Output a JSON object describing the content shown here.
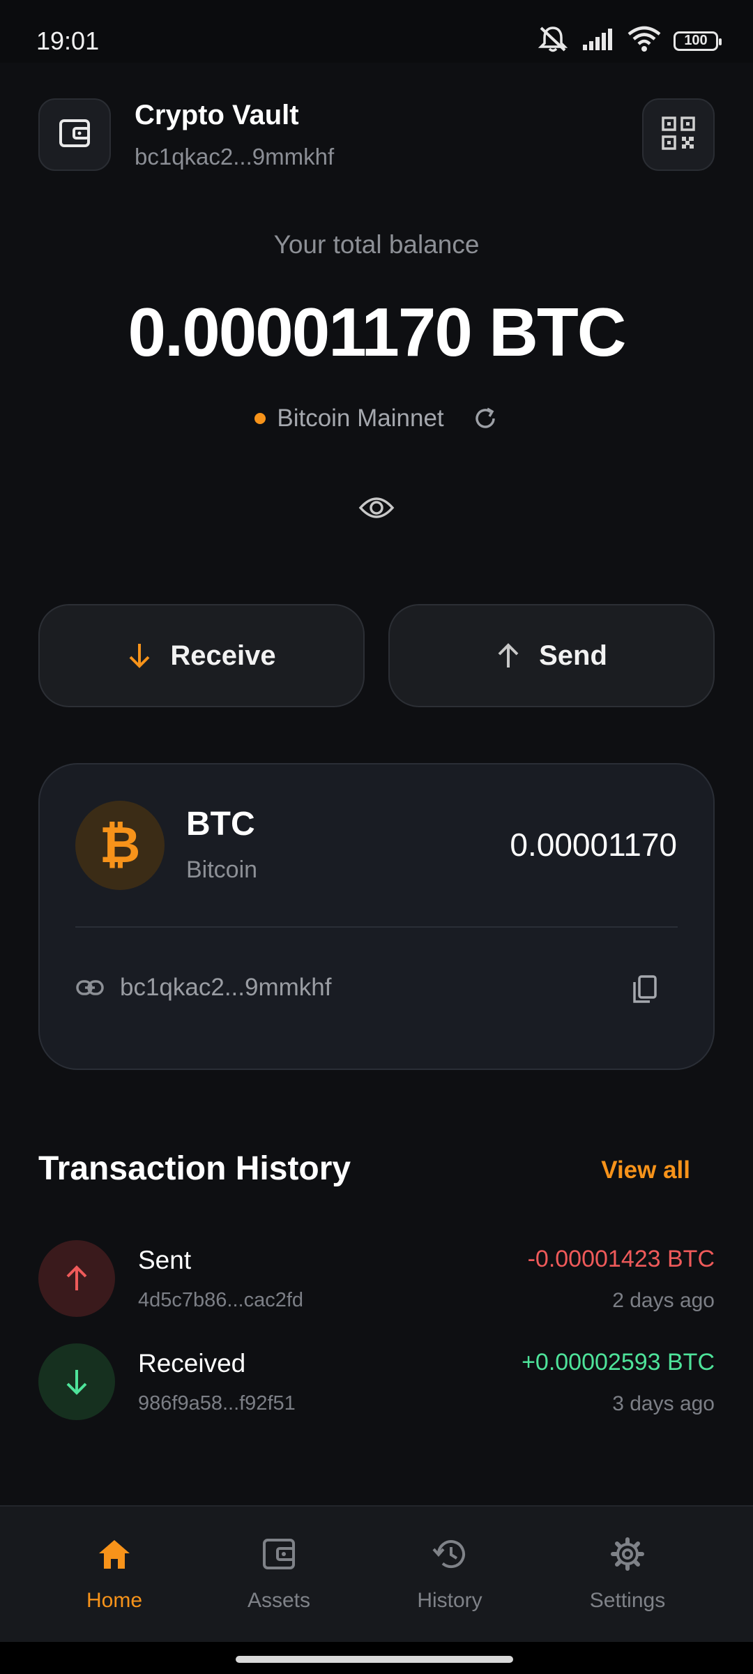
{
  "status": {
    "time": "19:01",
    "battery": "100"
  },
  "header": {
    "title": "Crypto Vault",
    "address": "bc1qkac2...9mmkhf",
    "wallet_icon": "wallet-icon",
    "qr_icon": "qr-code-icon"
  },
  "balance": {
    "caption": "Your total balance",
    "amount": "0.00001170 BTC",
    "network": "Bitcoin Mainnet"
  },
  "actions": {
    "receive": "Receive",
    "send": "Send"
  },
  "asset": {
    "symbol": "BTC",
    "name": "Bitcoin",
    "glyph": "₿",
    "amount": "0.00001170",
    "address": "bc1qkac2...9mmkhf"
  },
  "history": {
    "title": "Transaction History",
    "view_all": "View all",
    "items": [
      {
        "type": "Sent",
        "hash": "4d5c7b86...cac2fd",
        "amount": "-0.00001423 BTC",
        "time": "2 days ago"
      },
      {
        "type": "Received",
        "hash": "986f9a58...f92f51",
        "amount": "+0.00002593 BTC",
        "time": "3 days ago"
      }
    ]
  },
  "nav": {
    "items": [
      {
        "label": "Home"
      },
      {
        "label": "Assets"
      },
      {
        "label": "History"
      },
      {
        "label": "Settings"
      }
    ]
  },
  "colors": {
    "accent": "#f7931a",
    "sent": "#ef5a5a",
    "received": "#4ee39a",
    "background": "#0e0f12"
  }
}
